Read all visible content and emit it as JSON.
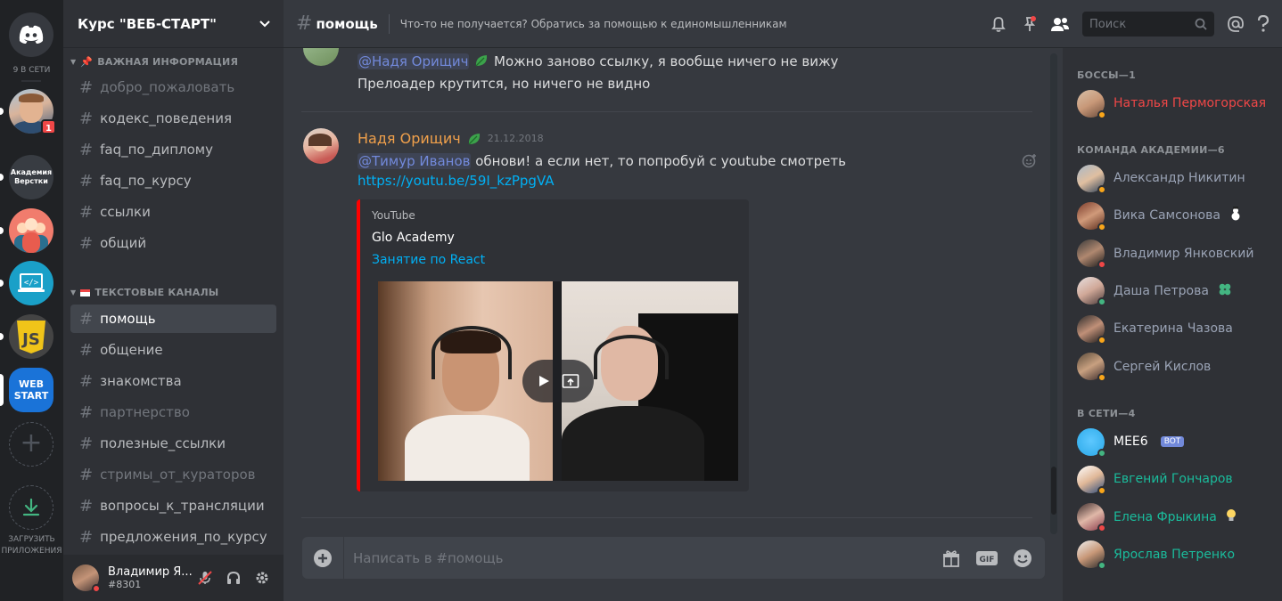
{
  "guild_bar": {
    "online_count": "9 В СЕТИ",
    "unread_badge": "1",
    "akademia_label": "Академия Верстки",
    "webstart_label_1": "WEB",
    "webstart_label_2": "START",
    "download_label_1": "ЗАГРУЗИТЬ",
    "download_label_2": "ПРИЛОЖЕНИЯ"
  },
  "server": {
    "name": "Курс \"ВЕБ-СТАРТ\""
  },
  "categories": {
    "important": "ВАЖНАЯ ИНФОРМАЦИЯ",
    "text": "ТЕКСТОВЫЕ КАНАЛЫ"
  },
  "channels_important": [
    {
      "name": "добро_пожаловать"
    },
    {
      "name": "кодекс_поведения"
    },
    {
      "name": "faq_по_диплому"
    },
    {
      "name": "faq_по_курсу"
    },
    {
      "name": "ссылки"
    },
    {
      "name": "общий"
    }
  ],
  "channels_text": [
    {
      "name": "помощь"
    },
    {
      "name": "общение"
    },
    {
      "name": "знакомства"
    },
    {
      "name": "партнерство"
    },
    {
      "name": "полезные_ссылки"
    },
    {
      "name": "стримы_от_кураторов"
    },
    {
      "name": "вопросы_к_трансляции"
    },
    {
      "name": "предложения_по_курсу"
    }
  ],
  "user": {
    "name": "Владимир Я...",
    "discriminator": "#8301"
  },
  "header": {
    "channel": "помощь",
    "topic": "Что-то не получается? Обратись за помощью к единомышленникам",
    "search_placeholder": "Поиск"
  },
  "messages": {
    "prev_mention": "@Надя Орищич",
    "prev_line1": " Можно заново ссылку, я вообще ничего не вижу",
    "prev_line2": "Прелоадер крутится, но ничего не видно",
    "author": "Надя Орищич",
    "timestamp": "21.12.2018",
    "mention": "@Тимур Иванов",
    "text": " обнови! а если нет, то попробуй с youtube смотреть",
    "link": "https://youtu.be/59I_kzPpgVA",
    "embed": {
      "provider": "YouTube",
      "author": "Glo Academy",
      "title": "Занятие по React"
    }
  },
  "composer": {
    "placeholder": "Написать в #помощь"
  },
  "members": {
    "role_bosses": "БОССЫ—1",
    "bosses": [
      {
        "name": "Наталья Пермогорская",
        "color": "#f04747"
      }
    ],
    "role_team": "КОМАНДА АКАДЕМИИ—6",
    "team": [
      {
        "name": "Александр Никитин"
      },
      {
        "name": "Вика Самсонова"
      },
      {
        "name": "Владимир Янковский"
      },
      {
        "name": "Даша Петрова"
      },
      {
        "name": "Екатерина Чазова"
      },
      {
        "name": "Сергей Кислов"
      }
    ],
    "team_color": "#9aa3b5",
    "role_online": "В СЕТИ—4",
    "online": [
      {
        "name": "MEE6",
        "bot": "BOT"
      },
      {
        "name": "Евгений Гончаров"
      },
      {
        "name": "Елена Фрыкина"
      },
      {
        "name": "Ярослав Петренко"
      }
    ],
    "online_color": "#1abc9c"
  }
}
